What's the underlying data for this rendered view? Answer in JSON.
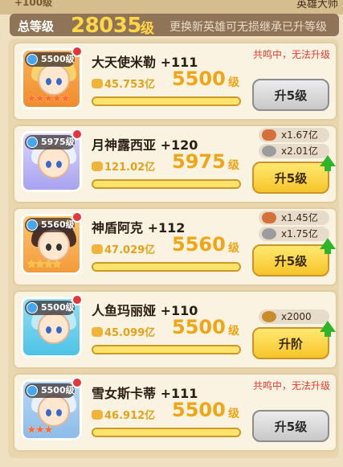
{
  "top": {
    "left_text": "+100级",
    "right_text": "英雄大师"
  },
  "level": {
    "label": "总等级",
    "value": "28035",
    "unit": "级",
    "note": "更换新英雄可无损继承已升等级"
  },
  "heroes": [
    {
      "name": "大天使米勒 +111",
      "badge_level": "5500级",
      "power": "45.753亿",
      "level": "5500",
      "level_unit": "级",
      "warning": "共鸣中，无法升级",
      "button": "升5级",
      "button_style": "gray",
      "costs": []
    },
    {
      "name": "月神露西亚 +120",
      "badge_level": "5975级",
      "power": "121.02亿",
      "level": "5975",
      "level_unit": "级",
      "warning": "",
      "button": "升5级",
      "button_style": "yellow",
      "costs": [
        "x1.67亿",
        "x2.01亿"
      ]
    },
    {
      "name": "神盾阿克 +112",
      "badge_level": "5560级",
      "power": "47.029亿",
      "level": "5560",
      "level_unit": "级",
      "warning": "",
      "button": "升5级",
      "button_style": "yellow",
      "costs": [
        "x1.45亿",
        "x1.75亿"
      ]
    },
    {
      "name": "人鱼玛丽娅 +110",
      "badge_level": "5500级",
      "power": "45.099亿",
      "level": "5500",
      "level_unit": "级",
      "warning": "",
      "button": "升阶",
      "button_style": "yellow",
      "costs": [
        "x2000"
      ]
    },
    {
      "name": "雪女斯卡蒂 +111",
      "badge_level": "5500级",
      "power": "46.912亿",
      "level": "5500",
      "level_unit": "级",
      "warning": "共鸣中，无法升级",
      "button": "升5级",
      "button_style": "gray",
      "costs": []
    }
  ],
  "colors": {
    "accent_orange": "#f0a516",
    "warning_red": "#e83c2e",
    "upgrade_green": "#2fb52c",
    "panel_brown": "#8f7458"
  }
}
